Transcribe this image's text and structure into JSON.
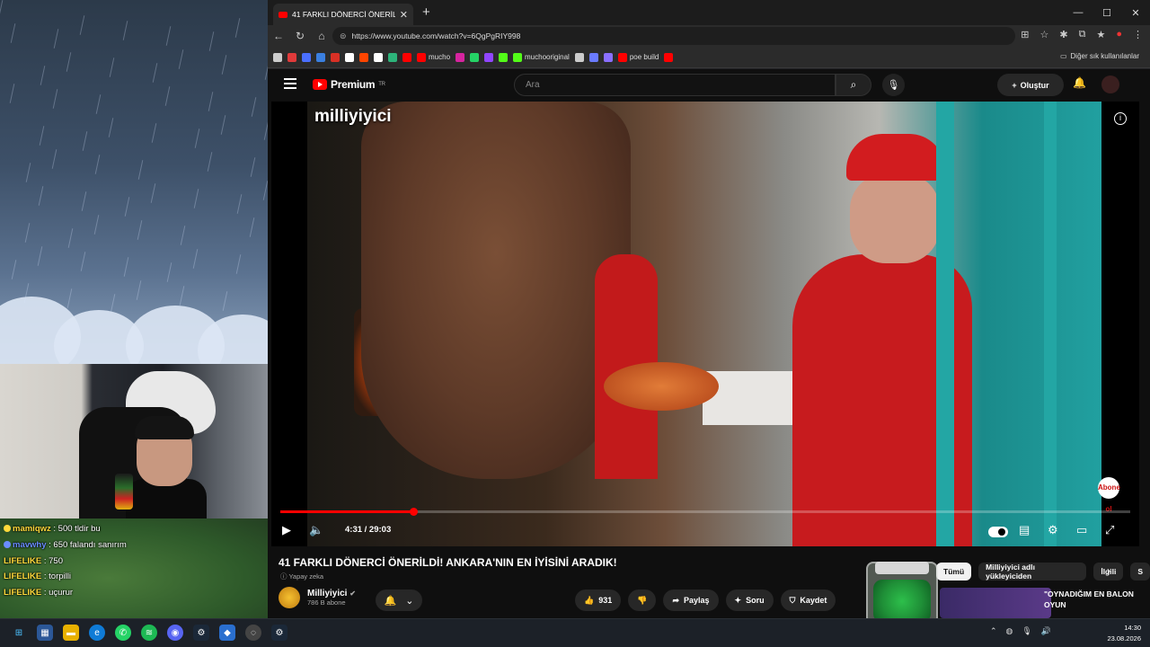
{
  "browser": {
    "tab_title": "41 FARKLI DÖNERCİ ÖNERİLDİ! AN",
    "url": "https://www.youtube.com/watch?v=6QgPgRIY998",
    "bookmarks": [
      {
        "label": "",
        "color": "#cccccc"
      },
      {
        "label": "",
        "color": "#e03a3a"
      },
      {
        "label": "",
        "color": "#4a6fff"
      },
      {
        "label": "",
        "color": "#3a7fe0"
      },
      {
        "label": "",
        "color": "#d93025"
      },
      {
        "label": "",
        "color": "#ffffff"
      },
      {
        "label": "",
        "color": "#ff4500"
      },
      {
        "label": "",
        "color": "#ffffff"
      },
      {
        "label": "",
        "color": "#2db37a"
      },
      {
        "label": "",
        "color": "#ff0000"
      },
      {
        "label": "mucho",
        "color": "#ff0000"
      },
      {
        "label": "",
        "color": "#d6249f"
      },
      {
        "label": "",
        "color": "#25d366"
      },
      {
        "label": "",
        "color": "#9146ff"
      },
      {
        "label": "",
        "color": "#53fc18"
      },
      {
        "label": "muchooriginal",
        "color": "#53fc18"
      },
      {
        "label": "",
        "color": "#cccccc"
      },
      {
        "label": "",
        "color": "#6a7bff"
      },
      {
        "label": "",
        "color": "#8a6fff"
      },
      {
        "label": "poe build",
        "color": "#ff0000"
      },
      {
        "label": "",
        "color": "#ff0000"
      }
    ],
    "bookmarks_other": "Diğer sık kullanılanlar"
  },
  "youtube": {
    "logo_text": "Premium",
    "region": "TR",
    "search_placeholder": "Ara",
    "create_label": "Oluştur",
    "watermark": "milliyiyici",
    "brand_mark": "Abone ol",
    "video_time": "4:31 / 29:03",
    "progress": 0.156,
    "title": "41 FARKLI DÖNERCİ ÖNERİLDİ! ANKARA'NIN EN İYİSİNİ ARADIK!",
    "ai_label": "Yapay zeka",
    "channel_name": "Milliyiyici",
    "subscribers": "786 B abone",
    "likes": "931",
    "share_label": "Paylaş",
    "ask_label": "Soru",
    "save_label": "Kaydet",
    "chips": [
      "Tümü",
      "Milliyiyici adlı yükleyiciden",
      "İlgili",
      "S"
    ],
    "recommended_title": "\"OYNADIĞIM EN BALON OYUN"
  },
  "stream_chat": [
    {
      "user": "mamiqwz",
      "message": " : 500 tldir bu",
      "color": "#ffd93b"
    },
    {
      "user": "mavwhy",
      "message": " : 650 falandı sanırım",
      "color": "#6a8cff"
    },
    {
      "user": "LIFELIKE",
      "message": " : 750",
      "color": "#ffd93b"
    },
    {
      "user": "LIFELIKE",
      "message": " : torpilli",
      "color": "#ffd93b"
    },
    {
      "user": "LIFELIKE",
      "message": " : uçurur",
      "color": "#ffd93b"
    }
  ],
  "taskbar": {
    "time": "14:30",
    "date": "23.08.2026"
  }
}
